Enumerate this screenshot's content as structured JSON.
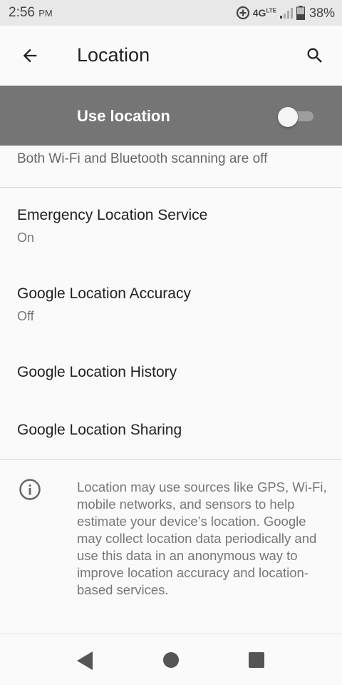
{
  "status_bar": {
    "time": "2:56",
    "time_suffix": "PM",
    "network": "4G",
    "network_sub": "LTE",
    "battery": "38%"
  },
  "app_bar": {
    "title": "Location"
  },
  "use_location": {
    "label": "Use location",
    "enabled": false
  },
  "scanning": {
    "summary": "Both Wi-Fi and Bluetooth scanning are off"
  },
  "items": [
    {
      "title": "Emergency Location Service",
      "summary": "On"
    },
    {
      "title": "Google Location Accuracy",
      "summary": "Off"
    },
    {
      "title": "Google Location History"
    },
    {
      "title": "Google Location Sharing"
    }
  ],
  "info": {
    "text": "Location may use sources like GPS, Wi-Fi, mobile networks, and sensors to help estimate your device’s location. Google may collect location data periodically and use this data in an anonymous way to improve location accuracy and location-based services."
  },
  "colors": {
    "toggle_bar": "#757575",
    "background": "#fafafa"
  }
}
